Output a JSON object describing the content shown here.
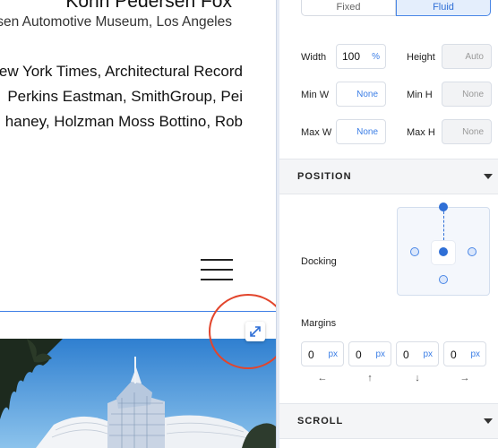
{
  "canvas": {
    "firm_name": "Kohn Pedersen Fox",
    "museum_line": "rsen Automotive Museum, Los Angeles",
    "press_line": "ew York Times, Architectural Record",
    "collab_line": "Perkins Eastman, SmithGroup, Pei",
    "collab_line2": "haney, Holzman Moss Bottino, Rob",
    "highlight_color": "#e2452c",
    "selection_color": "#3d7ee6"
  },
  "panel": {
    "size_mode": {
      "fixed": "Fixed",
      "fluid": "Fluid",
      "selected": "Fluid"
    },
    "width": {
      "label": "Width",
      "value": "100",
      "unit": "%"
    },
    "height": {
      "label": "Height",
      "value": "Auto"
    },
    "min_w": {
      "label": "Min W",
      "value": "None"
    },
    "min_h": {
      "label": "Min H",
      "value": "None"
    },
    "max_w": {
      "label": "Max W",
      "value": "None"
    },
    "max_h": {
      "label": "Max H",
      "value": "None"
    },
    "position_title": "POSITION",
    "docking_label": "Docking",
    "margins_label": "Margins",
    "margins": [
      {
        "value": "0",
        "unit": "px",
        "arrow": "←"
      },
      {
        "value": "0",
        "unit": "px",
        "arrow": "↑"
      },
      {
        "value": "0",
        "unit": "px",
        "arrow": "↓"
      },
      {
        "value": "0",
        "unit": "px",
        "arrow": "→"
      }
    ],
    "scroll_title": "SCROLL",
    "accent_color": "#2f6fd6"
  }
}
